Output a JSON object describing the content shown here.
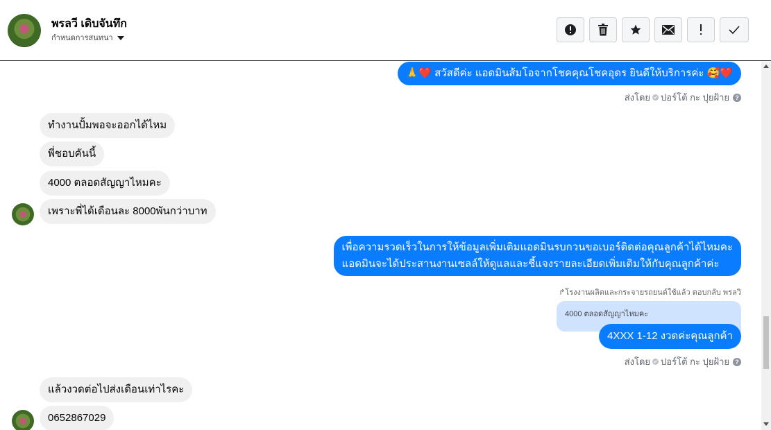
{
  "header": {
    "contact_name": "พรลวี เดิบจันทึก",
    "label_action": "กำหนดการสนทนา",
    "toolbar": [
      {
        "name": "report-button",
        "icon": "alert-circle-icon"
      },
      {
        "name": "delete-button",
        "icon": "trash-icon"
      },
      {
        "name": "star-button",
        "icon": "star-icon"
      },
      {
        "name": "mark-unread-button",
        "icon": "envelope-icon"
      },
      {
        "name": "spam-button",
        "icon": "exclamation-icon"
      },
      {
        "name": "mark-done-button",
        "icon": "checkmark-icon"
      }
    ]
  },
  "messages": {
    "m1": "🙏❤️ สวัสดีค่ะ แอดมินส้มโอจากโชคคุณโชคอุดร ยินดีให้บริการค่ะ 🥰❤️",
    "sent_by_1": {
      "prefix": "ส่งโดย",
      "agent": "ปอร์โต้ กะ ปุยฝ้าย"
    },
    "i1": "ทำงานปั้มพอจะออกได้ไหม",
    "i2": "พี่ชอบคันนี้",
    "i3": "4000  ตลอดสัญญาไหมคะ",
    "i4": "เพราะพี่ได้เดือนละ 8000พันกว่าบาท",
    "m2_line1": "เพื่อความรวดเร็วในการให้ข้อมูลเพิ่มเติมแอดมินรบกวนขอเบอร์ติดต่อคุณลูกค้าได้ไหมคะ",
    "m2_line2": "แอดมินจะได้ประสานงานเซลล์ให้ดูแลและชี้แจงรายละเอียดเพิ่มเติมให้กับคุณลูกค้าค่ะ",
    "reply_note": "↱โรงงานผลิตและกระจายรถยนต์ใช้แล้ว ตอบกลับ พรลวิ",
    "quoted": "4000  ตลอดสัญญาไหมคะ",
    "m3": "4XXX 1-12 งวดค่ะคุณลูกค้า",
    "sent_by_2": {
      "prefix": "ส่งโดย",
      "agent": "ปอร์โต้ กะ ปุยฝ้าย"
    },
    "i5": "แล้วงวดต่อไปส่งเดือนเท่าไรคะ",
    "i6": "0652867029"
  },
  "colors": {
    "outgoing_bubble": "#0a7cff",
    "incoming_bubble": "#f0f0f0",
    "quoted_bubble": "#cfe3ff"
  }
}
